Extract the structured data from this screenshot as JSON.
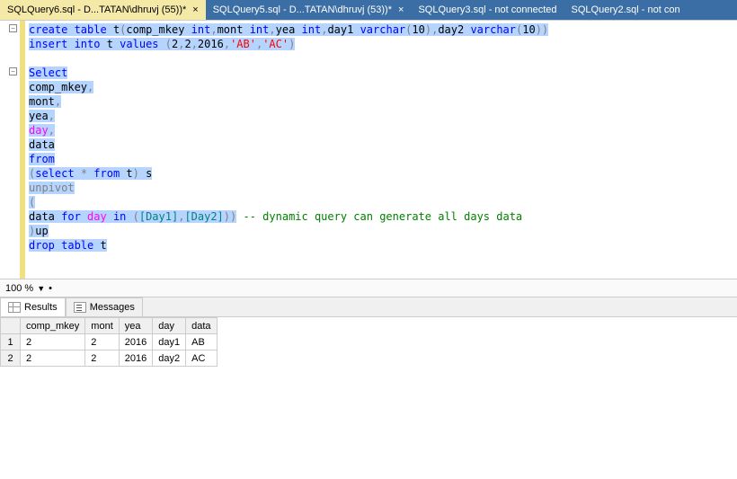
{
  "tabs": [
    {
      "label": "SQLQuery6.sql - D...TATAN\\dhruvj (55))*",
      "active": true,
      "closeable": true
    },
    {
      "label": "SQLQuery5.sql - D...TATAN\\dhruvj (53))*",
      "active": false,
      "closeable": true
    },
    {
      "label": "SQLQuery3.sql - not connected",
      "active": false,
      "closeable": false
    },
    {
      "label": "SQLQuery2.sql - not con",
      "active": false,
      "closeable": false
    }
  ],
  "zoom": "100 %",
  "resultTabs": {
    "results": "Results",
    "messages": "Messages"
  },
  "code": {
    "l1": {
      "a": "create",
      "b": " table",
      "c": " t",
      "d": "(",
      "e": "comp_mkey ",
      "f": "int",
      "g": ",",
      "h": "mont ",
      "i": "int",
      "j": ",",
      "k": "yea ",
      "l": "int",
      "m": ",",
      "n": "day1 ",
      "o": "varchar",
      "p": "(",
      "q": "10",
      "r": ")",
      "s": ",",
      "t": "day2 ",
      "u": "varchar",
      "v": "(",
      "w": "10",
      "x": "))"
    },
    "l2": {
      "a": "insert",
      "b": " into",
      "c": " t ",
      "d": "values",
      "e": " (",
      "f": "2",
      "g": ",",
      "h": "2",
      "i": ",",
      "j": "2016",
      "k": ",",
      "l": "'AB'",
      "m": ",",
      "n": "'AC'",
      "o": ")"
    },
    "l3": "",
    "l4": {
      "a": "Select"
    },
    "l5": {
      "a": "comp_mkey",
      "b": ","
    },
    "l6": {
      "a": "mont",
      "b": ","
    },
    "l7": {
      "a": "yea",
      "b": ","
    },
    "l8": {
      "a": "day",
      "b": ","
    },
    "l9": {
      "a": "data"
    },
    "l10": {
      "a": "from"
    },
    "l11": {
      "a": "(",
      "b": "select",
      "c": " *",
      "d": " from",
      "e": " t",
      "f": ")",
      "g": " s"
    },
    "l12": {
      "a": "unpivot"
    },
    "l13": {
      "a": "("
    },
    "l14": {
      "a": "data ",
      "b": "for",
      "c": " day ",
      "d": "in",
      "e": " (",
      "f": "[Day1]",
      "g": ",",
      "h": "[Day2]",
      "i": ")",
      "j": ")",
      "k": " -- dynamic query can generate all days data"
    },
    "l15": {
      "a": ")",
      "b": "up"
    },
    "l16": {
      "a": "drop",
      "b": " table",
      "c": " t"
    }
  },
  "grid": {
    "headers": [
      "",
      "comp_mkey",
      "mont",
      "yea",
      "day",
      "data"
    ],
    "rows": [
      [
        "1",
        "2",
        "2",
        "2016",
        "day1",
        "AB"
      ],
      [
        "2",
        "2",
        "2",
        "2016",
        "day2",
        "AC"
      ]
    ]
  }
}
